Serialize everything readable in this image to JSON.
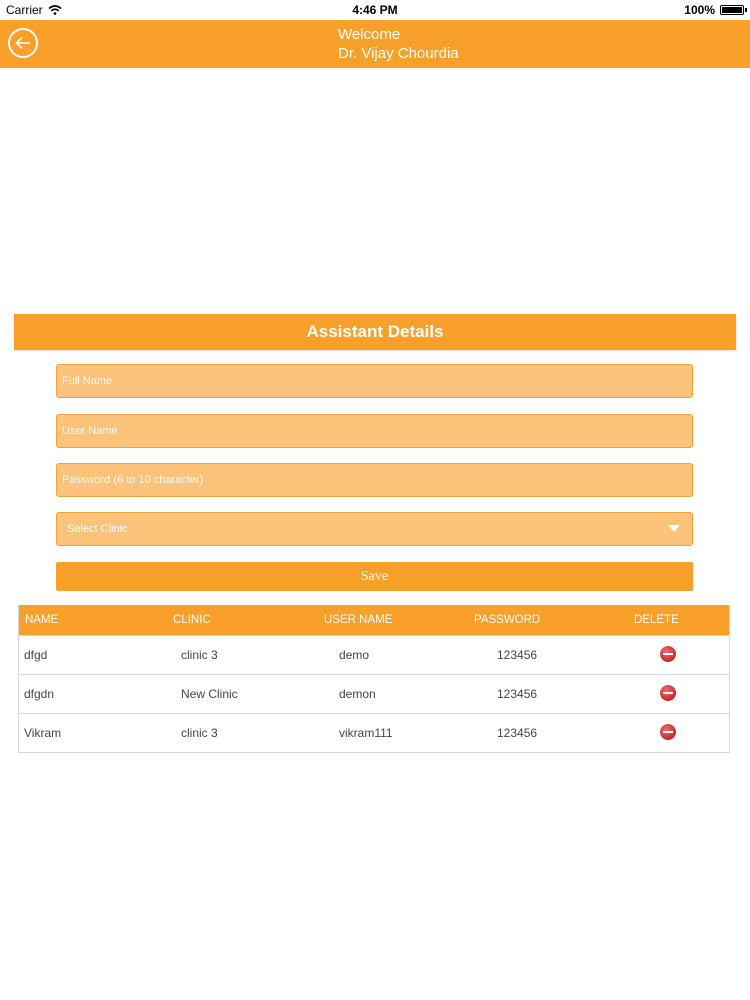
{
  "status_bar": {
    "carrier": "Carrier",
    "time": "4:46 PM",
    "battery": "100%",
    "battery_level": 1.0
  },
  "header": {
    "welcome": "Welcome",
    "doctor_name": "Dr. Vijay Chourdia"
  },
  "section": {
    "title": "Assistant Details"
  },
  "form": {
    "full_name_placeholder": "Full Name",
    "user_name_placeholder": "User Name",
    "password_placeholder": "Password (6 to 10 character)",
    "clinic_selected": "Select Clinic",
    "save_label": "Save"
  },
  "table": {
    "headers": {
      "name": "NAME",
      "clinic": "CLINIC",
      "user_name": "USER NAME",
      "password": "PASSWORD",
      "delete": "DELETE"
    },
    "rows": [
      {
        "name": "dfgd",
        "clinic": "clinic 3",
        "user_name": "demo",
        "password": "123456"
      },
      {
        "name": "dfgdn",
        "clinic": "New Clinic",
        "user_name": "demon",
        "password": "123456"
      },
      {
        "name": "Vikram",
        "clinic": "clinic 3",
        "user_name": "vikram111",
        "password": "123456"
      }
    ]
  },
  "colors": {
    "accent": "#f9a02a",
    "field_bg": "#fdc37a",
    "delete_red": "#c8141c"
  },
  "icons": {
    "back": "back-arrow-icon",
    "wifi": "wifi-icon",
    "battery": "battery-icon",
    "delete": "delete-icon",
    "dropdown": "chevron-down-icon"
  }
}
